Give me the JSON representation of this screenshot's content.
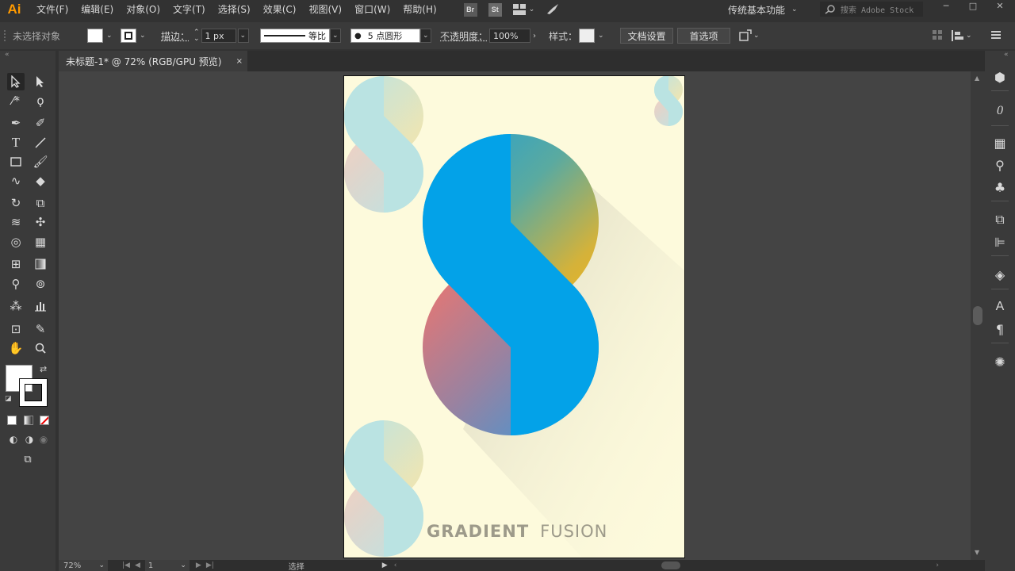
{
  "app": {
    "logo": "Ai"
  },
  "menu": [
    "文件(F)",
    "编辑(E)",
    "对象(O)",
    "文字(T)",
    "选择(S)",
    "效果(C)",
    "视图(V)",
    "窗口(W)",
    "帮助(H)"
  ],
  "menubar_icons": {
    "bridge": "Br",
    "stock": "St"
  },
  "workspace": {
    "label": "传统基本功能"
  },
  "stock_search": {
    "placeholder": "搜索 Adobe Stock"
  },
  "control": {
    "selection": "未选择对象",
    "stroke_label": "描边：",
    "stroke_value": "1 px",
    "profile": "等比",
    "brush": "5 点圆形",
    "opacity_label": "不透明度：",
    "opacity_value": "100%",
    "style_label": "样式：",
    "doc_setup": "文档设置",
    "prefs": "首选项"
  },
  "tab": {
    "title": "未标题-1* @ 72% (RGB/GPU 预览)",
    "close": "×"
  },
  "artwork": {
    "text_bold": "GRADIENT",
    "text_light": "FUSION"
  },
  "status": {
    "zoom": "72%",
    "artboard": "1",
    "tool": "选择"
  },
  "colors": {
    "accent": "#ff9a00",
    "artboard_bg": "#fdfadc",
    "s_blue": "#03a2e8"
  }
}
